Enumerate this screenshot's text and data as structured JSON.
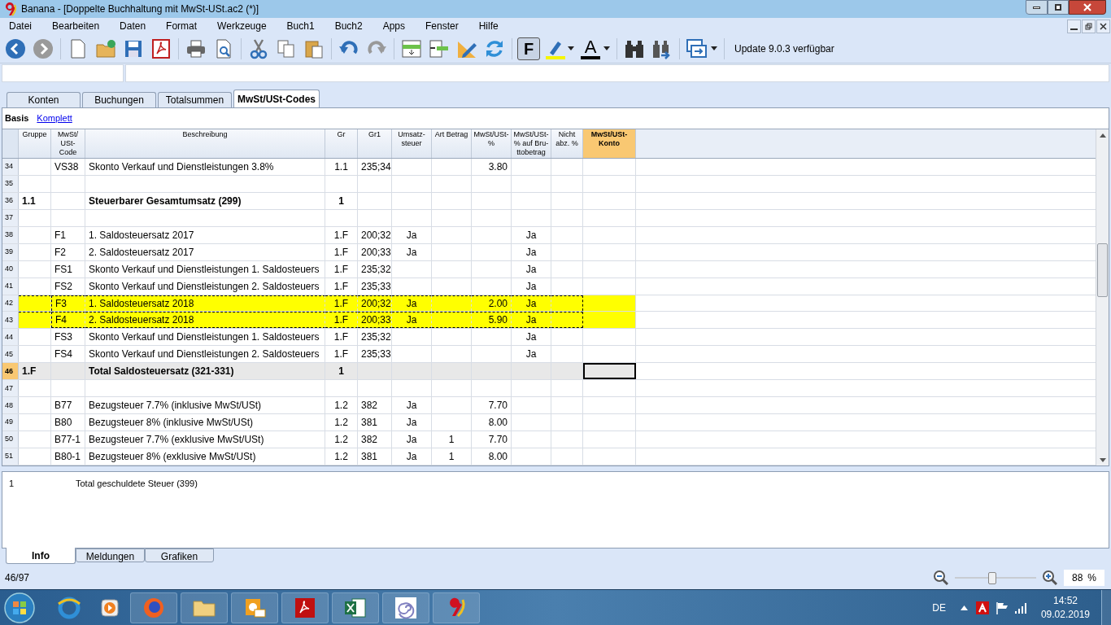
{
  "window": {
    "title": "Banana - [Doppelte Buchhaltung mit MwSt-USt.ac2 (*)]"
  },
  "menu": [
    "Datei",
    "Bearbeiten",
    "Daten",
    "Format",
    "Werkzeuge",
    "Buch1",
    "Buch2",
    "Apps",
    "Fenster",
    "Hilfe"
  ],
  "toolbar": {
    "bold_button": "F",
    "font_color_button": "A",
    "update_notice": "Update 9.0.3 verfügbar"
  },
  "tabs": [
    {
      "label": "Konten",
      "selected": false
    },
    {
      "label": "Buchungen",
      "selected": false
    },
    {
      "label": "Totalsummen",
      "selected": false
    },
    {
      "label": "MwSt/USt-Codes",
      "selected": true
    }
  ],
  "views": [
    {
      "label": "Basis",
      "selected": true
    },
    {
      "label": "Komplett",
      "selected": false
    }
  ],
  "table": {
    "columns": [
      {
        "label": "Gruppe",
        "selected": false
      },
      {
        "label": "MwSt/ USt- Code",
        "selected": false
      },
      {
        "label": "Beschreibung",
        "selected": false
      },
      {
        "label": "Gr",
        "selected": false
      },
      {
        "label": "Gr1",
        "selected": false
      },
      {
        "label": "Umsatz- steuer",
        "selected": false
      },
      {
        "label": "Art Betrag",
        "selected": false
      },
      {
        "label": "MwSt/USt- %",
        "selected": false
      },
      {
        "label": "MwSt/USt- % auf Bru- ttobetrag",
        "selected": false
      },
      {
        "label": "Nicht abz. %",
        "selected": false
      },
      {
        "label": "MwSt/USt- Konto",
        "selected": true
      }
    ],
    "rows": [
      {
        "num": "34",
        "cells": [
          "",
          "VS38",
          "Skonto Verkauf und Dienstleistungen 3.8%",
          "1.1",
          "235;34",
          "",
          "",
          "3.80",
          "",
          ""
        ],
        "bold": false,
        "selected": false,
        "current": false
      },
      {
        "num": "35",
        "cells": [
          "",
          "",
          "",
          "",
          "",
          "",
          "",
          "",
          "",
          ""
        ],
        "selected": false,
        "current": false
      },
      {
        "num": "36",
        "cells": [
          "1.1",
          "",
          "Steuerbarer Gesamtumsatz (299)",
          "1",
          "",
          "",
          "",
          "",
          "",
          ""
        ],
        "bold": true,
        "selected": false,
        "current": false
      },
      {
        "num": "37",
        "cells": [
          "",
          "",
          "",
          "",
          "",
          "",
          "",
          "",
          "",
          ""
        ],
        "selected": false,
        "current": false
      },
      {
        "num": "38",
        "cells": [
          "",
          "F1",
          "1. Saldosteuersatz 2017",
          "1.F",
          "200;32",
          "Ja",
          "",
          "",
          "Ja",
          ""
        ],
        "bold": false,
        "selected": false,
        "current": false
      },
      {
        "num": "39",
        "cells": [
          "",
          "F2",
          "2. Saldosteuersatz 2017",
          "1.F",
          "200;33",
          "Ja",
          "",
          "",
          "Ja",
          ""
        ],
        "bold": false,
        "selected": false,
        "current": false
      },
      {
        "num": "40",
        "cells": [
          "",
          "FS1",
          "Skonto Verkauf und Dienstleistungen 1. Saldosteuers",
          "1.F",
          "235;32",
          "",
          "",
          "",
          "Ja",
          ""
        ],
        "bold": false,
        "selected": false,
        "current": false
      },
      {
        "num": "41",
        "cells": [
          "",
          "FS2",
          "Skonto Verkauf und Dienstleistungen 2. Saldosteuers",
          "1.F",
          "235;33",
          "",
          "",
          "",
          "Ja",
          ""
        ],
        "bold": false,
        "selected": false,
        "current": false
      },
      {
        "num": "42",
        "cells": [
          "",
          "F3",
          "1. Saldosteuersatz 2018",
          "1.F",
          "200;32",
          "Ja",
          "",
          "2.00",
          "Ja",
          ""
        ],
        "bold": false,
        "selected": true,
        "current": false
      },
      {
        "num": "43",
        "cells": [
          "",
          "F4",
          "2. Saldosteuersatz 2018",
          "1.F",
          "200;33",
          "Ja",
          "",
          "5.90",
          "Ja",
          ""
        ],
        "bold": false,
        "selected": true,
        "current": false
      },
      {
        "num": "44",
        "cells": [
          "",
          "FS3",
          "Skonto Verkauf und Dienstleistungen 1. Saldosteuers",
          "1.F",
          "235;32",
          "",
          "",
          "",
          "Ja",
          ""
        ],
        "bold": false,
        "selected": false,
        "current": false
      },
      {
        "num": "45",
        "cells": [
          "",
          "FS4",
          "Skonto Verkauf und Dienstleistungen 2. Saldosteuers",
          "1.F",
          "235;33",
          "",
          "",
          "",
          "Ja",
          ""
        ],
        "bold": false,
        "selected": false,
        "current": false
      },
      {
        "num": "46",
        "cells": [
          "1.F",
          "",
          "Total Saldosteuersatz (321-331)",
          "1",
          "",
          "",
          "",
          "",
          "",
          ""
        ],
        "bold": true,
        "selected": false,
        "current": true
      },
      {
        "num": "47",
        "cells": [
          "",
          "",
          "",
          "",
          "",
          "",
          "",
          "",
          "",
          ""
        ],
        "selected": false,
        "current": false
      },
      {
        "num": "48",
        "cells": [
          "",
          "B77",
          "Bezugsteuer 7.7%  (inklusive MwSt/USt)",
          "1.2",
          "382",
          "Ja",
          "",
          "7.70",
          "",
          ""
        ],
        "bold": false,
        "selected": false,
        "current": false
      },
      {
        "num": "49",
        "cells": [
          "",
          "B80",
          "Bezugsteuer 8%  (inklusive MwSt/USt)",
          "1.2",
          "381",
          "Ja",
          "",
          "8.00",
          "",
          ""
        ],
        "bold": false,
        "selected": false,
        "current": false
      },
      {
        "num": "50",
        "cells": [
          "",
          "B77-1",
          "Bezugsteuer 7.7%  (exklusive MwSt/USt)",
          "1.2",
          "382",
          "Ja",
          "1",
          "7.70",
          "",
          ""
        ],
        "bold": false,
        "selected": false,
        "current": false
      },
      {
        "num": "51",
        "cells": [
          "",
          "B80-1",
          "Bezugsteuer 8%  (exklusive MwSt/USt)",
          "1.2",
          "381",
          "Ja",
          "1",
          "8.00",
          "",
          ""
        ],
        "bold": false,
        "selected": false,
        "current": false
      }
    ]
  },
  "info_panel": {
    "lines": [
      {
        "number": "1",
        "text": "Total geschuldete Steuer (399)"
      }
    ],
    "tabs": [
      {
        "label": "Info",
        "selected": true
      },
      {
        "label": "Meldungen",
        "selected": false
      },
      {
        "label": "Grafiken",
        "selected": false
      }
    ]
  },
  "status_bar": {
    "position": "46/97",
    "zoom": {
      "level": 0.45,
      "value": "88",
      "unit": "%"
    }
  },
  "taskbar": {
    "language": "DE",
    "time": "14:52",
    "date": "09.02.2019"
  }
}
